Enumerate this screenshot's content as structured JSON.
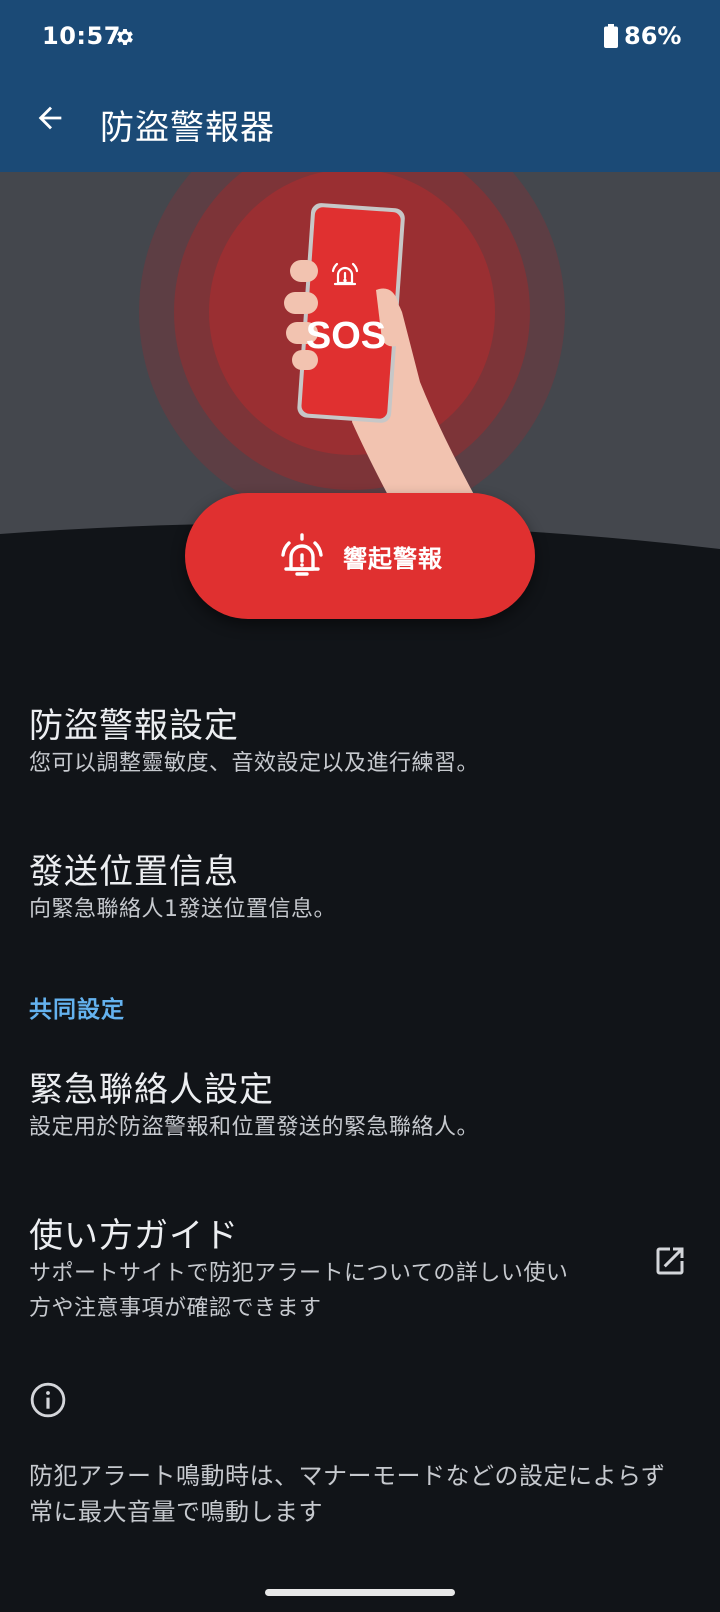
{
  "status_bar": {
    "time": "10:57",
    "battery_percent": "86%",
    "icons": [
      "gear-icon",
      "battery-icon"
    ]
  },
  "app_bar": {
    "title": "防盜警報器",
    "back_icon": "arrow-left-icon"
  },
  "hero": {
    "phone_screen_text": "SOS",
    "colors": {
      "alarm_red": "#e03030",
      "hero_bg": "#44474d",
      "appbar_blue": "#1b4a76"
    }
  },
  "sos_button": {
    "label": "響起警報",
    "icon": "alarm-bell-icon"
  },
  "items": [
    {
      "title": "防盜警報設定",
      "description": "您可以調整靈敏度、音效設定以及進行練習。"
    },
    {
      "title": "發送位置信息",
      "description": "向緊急聯絡人1發送位置信息。"
    }
  ],
  "section_header": "共同設定",
  "common_items": [
    {
      "title": "緊急聯絡人設定",
      "description": "設定用於防盜警報和位置發送的緊急聯絡人。"
    },
    {
      "title": "使い方ガイド",
      "description_lines": [
        "サポートサイトで防犯アラートについての詳しい使い",
        "方や注意事項が確認できます"
      ],
      "trailing_icon": "open-external-icon"
    }
  ],
  "info": {
    "icon": "info-icon",
    "lines": [
      "防犯アラート鳴動時は、マナーモードなどの設定によらず",
      "常に最大音量で鳴動します"
    ]
  },
  "accent_color": "#64b2ef"
}
